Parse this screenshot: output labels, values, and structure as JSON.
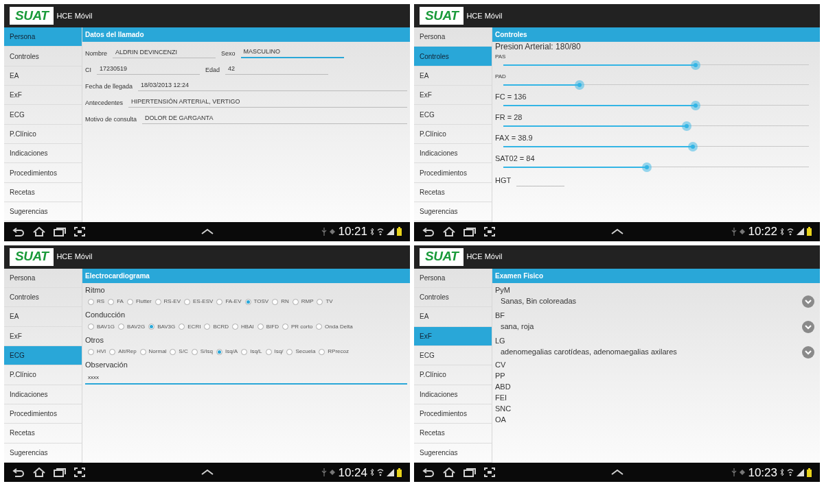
{
  "screens": [
    {
      "logo": "SUAT",
      "app_title": "HCE Móvil",
      "sidebar": [
        {
          "label": "Persona",
          "selected": true
        },
        {
          "label": "Controles",
          "selected": false
        },
        {
          "label": "EA",
          "selected": false
        },
        {
          "label": "ExF",
          "selected": false
        },
        {
          "label": "ECG",
          "selected": false
        },
        {
          "label": "P.Clínico",
          "selected": false
        },
        {
          "label": "Indicaciones",
          "selected": false
        },
        {
          "label": "Procedimientos",
          "selected": false
        },
        {
          "label": "Recetas",
          "selected": false
        },
        {
          "label": "Sugerencias",
          "selected": false
        }
      ],
      "section_title": "Datos del llamado",
      "content": [
        {
          "kind": "form-row",
          "fields": [
            {
              "label": "Nombre",
              "value": "ALDRIN DEVINCENZI",
              "focused": false
            },
            {
              "label": "Sexo",
              "value": "MASCULINO",
              "focused": true
            }
          ]
        },
        {
          "kind": "form-row",
          "fields": [
            {
              "label": "CI",
              "value": "17230519",
              "focused": false
            },
            {
              "label": "Edad",
              "value": "42",
              "focused": false
            }
          ]
        },
        {
          "kind": "form-row",
          "fields": [
            {
              "label": "Fecha de llegada",
              "value": "18/03/2013 12:24",
              "focused": false
            }
          ]
        },
        {
          "kind": "form-row",
          "fields": [
            {
              "label": "Antecedentes",
              "value": "HIPERTENSIÓN ARTERIAL, VERTIGO",
              "focused": false
            }
          ]
        },
        {
          "kind": "form-row",
          "fields": [
            {
              "label": "Motivo de consulta",
              "value": "DOLOR DE GARGANTA",
              "focused": false
            }
          ]
        }
      ],
      "time": "10:21"
    },
    {
      "logo": "SUAT",
      "app_title": "HCE Móvil",
      "sidebar": [
        {
          "label": "Persona",
          "selected": false
        },
        {
          "label": "Controles",
          "selected": true
        },
        {
          "label": "EA",
          "selected": false
        },
        {
          "label": "ExF",
          "selected": false
        },
        {
          "label": "ECG",
          "selected": false
        },
        {
          "label": "P.Clínico",
          "selected": false
        },
        {
          "label": "Indicaciones",
          "selected": false
        },
        {
          "label": "Procedimientos",
          "selected": false
        },
        {
          "label": "Recetas",
          "selected": false
        },
        {
          "label": "Sugerencias",
          "selected": false
        }
      ],
      "section_title": "Controles",
      "content": [
        {
          "kind": "heading",
          "label": "Presion Arterial: 180/80"
        },
        {
          "kind": "small-slider",
          "label": "PAS",
          "level": 0.63
        },
        {
          "kind": "small-slider",
          "label": "PAD",
          "level": 0.25
        },
        {
          "kind": "slider",
          "label": "FC = 136",
          "level": 0.63
        },
        {
          "kind": "slider",
          "label": "FR = 28",
          "level": 0.6
        },
        {
          "kind": "slider",
          "label": "FAX = 38.9",
          "level": 0.62
        },
        {
          "kind": "slider",
          "label": "SAT02 = 84",
          "level": 0.47
        },
        {
          "kind": "inline-field",
          "label": "HGT"
        }
      ],
      "time": "10:22"
    },
    {
      "logo": "SUAT",
      "app_title": "HCE Móvil",
      "sidebar": [
        {
          "label": "Persona",
          "selected": false
        },
        {
          "label": "Controles",
          "selected": false
        },
        {
          "label": "EA",
          "selected": false
        },
        {
          "label": "ExF",
          "selected": false
        },
        {
          "label": "ECG",
          "selected": true
        },
        {
          "label": "P.Clínico",
          "selected": false
        },
        {
          "label": "Indicaciones",
          "selected": false
        },
        {
          "label": "Procedimientos",
          "selected": false
        },
        {
          "label": "Recetas",
          "selected": false
        },
        {
          "label": "Sugerencias",
          "selected": false
        }
      ],
      "section_title": "Electrocardiograma",
      "content": [
        {
          "kind": "radio-group",
          "label": "Ritmo",
          "options": [
            {
              "label": "RS",
              "selected": false
            },
            {
              "label": "FA",
              "selected": false
            },
            {
              "label": "Flutter",
              "selected": false
            },
            {
              "label": "RS-EV",
              "selected": false
            },
            {
              "label": "ES-ESV",
              "selected": false
            },
            {
              "label": "FA-EV",
              "selected": false
            },
            {
              "label": "TOSV",
              "selected": true
            },
            {
              "label": "RN",
              "selected": false
            },
            {
              "label": "RMP",
              "selected": false
            },
            {
              "label": "TV",
              "selected": false
            }
          ]
        },
        {
          "kind": "radio-group",
          "label": "Conducción",
          "options": [
            {
              "label": "BAV1G",
              "selected": false
            },
            {
              "label": "BAV2G",
              "selected": false
            },
            {
              "label": "BAV3G",
              "selected": true
            },
            {
              "label": "ECRI",
              "selected": false
            },
            {
              "label": "BCRD",
              "selected": false
            },
            {
              "label": "HBAI",
              "selected": false
            },
            {
              "label": "BIFD",
              "selected": false
            },
            {
              "label": "PR corto",
              "selected": false
            },
            {
              "label": "Onda Delta",
              "selected": false
            }
          ]
        },
        {
          "kind": "radio-group",
          "label": "Otros",
          "options": [
            {
              "label": "HVI",
              "selected": false
            },
            {
              "label": "Alt/Rep",
              "selected": false
            },
            {
              "label": "Normal",
              "selected": false
            },
            {
              "label": "S/C",
              "selected": false
            },
            {
              "label": "S/Isq",
              "selected": false
            },
            {
              "label": "Isq/A",
              "selected": true
            },
            {
              "label": "Isq/L",
              "selected": false
            },
            {
              "label": "Isq/",
              "selected": false
            },
            {
              "label": "Secuela",
              "selected": false
            },
            {
              "label": "RPrecoz",
              "selected": false
            }
          ]
        },
        {
          "kind": "text-area",
          "label": "Observación",
          "value": "xxxx"
        }
      ],
      "time": "10:24"
    },
    {
      "logo": "SUAT",
      "app_title": "HCE Móvil",
      "sidebar": [
        {
          "label": "Persona",
          "selected": false
        },
        {
          "label": "Controles",
          "selected": false
        },
        {
          "label": "EA",
          "selected": false
        },
        {
          "label": "ExF",
          "selected": true
        },
        {
          "label": "ECG",
          "selected": false
        },
        {
          "label": "P.Clínico",
          "selected": false
        },
        {
          "label": "Indicaciones",
          "selected": false
        },
        {
          "label": "Procedimientos",
          "selected": false
        },
        {
          "label": "Recetas",
          "selected": false
        },
        {
          "label": "Sugerencias",
          "selected": false
        }
      ],
      "section_title": "Examen Fisico",
      "content": [
        {
          "kind": "select",
          "label": "PyM",
          "value": "Sanas, Bin coloreadas"
        },
        {
          "kind": "select",
          "label": "BF",
          "value": "sana, roja"
        },
        {
          "kind": "select",
          "label": "LG",
          "value": "adenomegalias carotídeas, adenomaegalias axilares"
        },
        {
          "kind": "label",
          "label": "CV"
        },
        {
          "kind": "label",
          "label": "PP"
        },
        {
          "kind": "label",
          "label": "ABD"
        },
        {
          "kind": "label",
          "label": "FEI"
        },
        {
          "kind": "label",
          "label": "SNC"
        },
        {
          "kind": "label",
          "label": "OA"
        }
      ],
      "time": "10:23"
    }
  ]
}
